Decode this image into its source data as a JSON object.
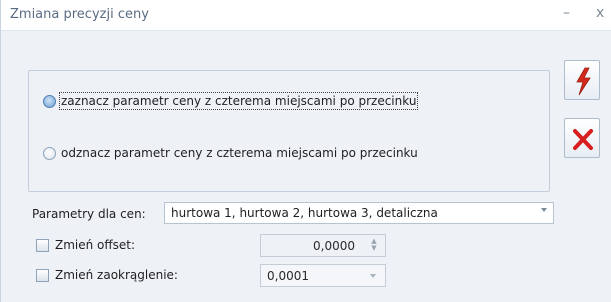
{
  "window": {
    "title": "Zmiana precyzji ceny",
    "minimize_glyph": "–",
    "close_glyph": "x"
  },
  "options": {
    "set_label": "zaznacz parametr ceny z czterema miejscami po przecinku",
    "unset_label": "odznacz parametr ceny z czterema miejscami po przecinku",
    "selected": "set"
  },
  "buttons": {
    "confirm_icon": "lightning-icon",
    "cancel_icon": "red-x-icon"
  },
  "prices": {
    "label": "Parametry dla cen:",
    "value": "hurtowa 1, hurtowa 2, hurtowa 3, detaliczna"
  },
  "offset": {
    "label": "Zmień offset:",
    "value": "0,0000",
    "checked": false
  },
  "rounding": {
    "label": "Zmień zaokrąglenie:",
    "value": "0,0001",
    "checked": false
  },
  "colors": {
    "accent": "#4f7fb3",
    "cancel_red": "#d81f1f",
    "confirm_red": "#d42a1e"
  }
}
